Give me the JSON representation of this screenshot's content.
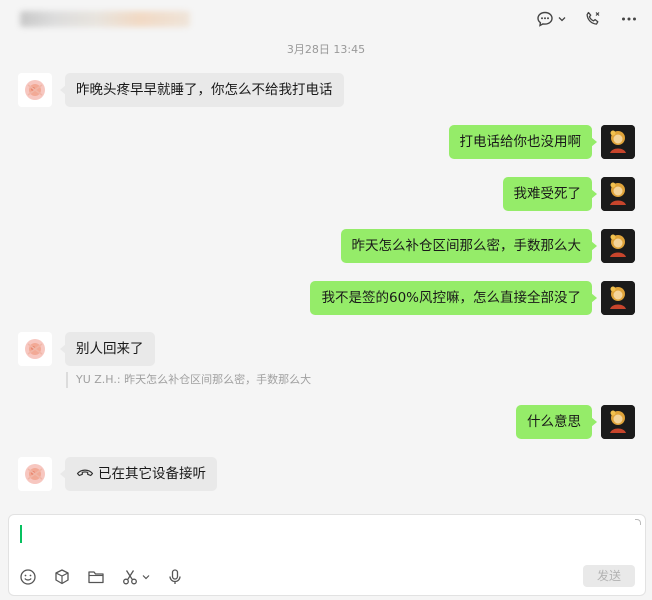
{
  "header": {
    "chat_title": "",
    "icons": [
      "chat-options-icon",
      "chevron-down-icon",
      "call-icon",
      "more-icon"
    ]
  },
  "conversation": {
    "timestamp": "3月28日 13:45",
    "messages": [
      {
        "side": "left",
        "text": "昨晚头疼早早就睡了，你怎么不给我打电话"
      },
      {
        "side": "right",
        "text": "打电话给你也没用啊"
      },
      {
        "side": "right",
        "text": "我难受死了"
      },
      {
        "side": "right",
        "text": "昨天怎么补仓区间那么密，手数那么大"
      },
      {
        "side": "right",
        "text": "我不是签的60%风控嘛，怎么直接全部没了"
      },
      {
        "side": "left",
        "text": "别人回来了",
        "quote": "YU Z.H.: 昨天怎么补仓区间那么密，手数那么大"
      },
      {
        "side": "right",
        "text": "什么意思"
      },
      {
        "side": "left",
        "text": "已在其它设备接听",
        "type": "call",
        "icon": "phone-hangup-icon"
      }
    ]
  },
  "composer": {
    "input_value": "",
    "send_label": "发送",
    "tools": [
      "emoji-icon",
      "sticker-box-icon",
      "folder-icon",
      "scissors-icon",
      "microphone-icon"
    ]
  },
  "colors": {
    "self_bubble": "#95ec69",
    "friend_bubble": "#e9e9e9",
    "caret": "#07c160",
    "background": "#f5f5f5"
  }
}
